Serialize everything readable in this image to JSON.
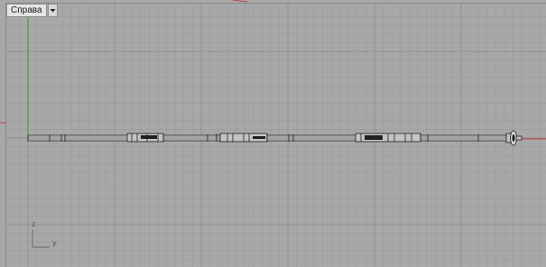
{
  "viewport": {
    "title": "Справа",
    "menu_icon": "dropdown-arrow-icon",
    "background_color": "#a8a8a8",
    "grid_minor_color": "#9c9c9c",
    "grid_major_color": "#8f8f8f",
    "axis_green_color": "#3ea33e",
    "axis_red_color": "#c24040",
    "object_outline_color": "#1f1f1f",
    "object_fill_color": "#cfcfcf"
  },
  "axis_indicator": {
    "vertical_label": "z",
    "horizontal_label": "y"
  }
}
